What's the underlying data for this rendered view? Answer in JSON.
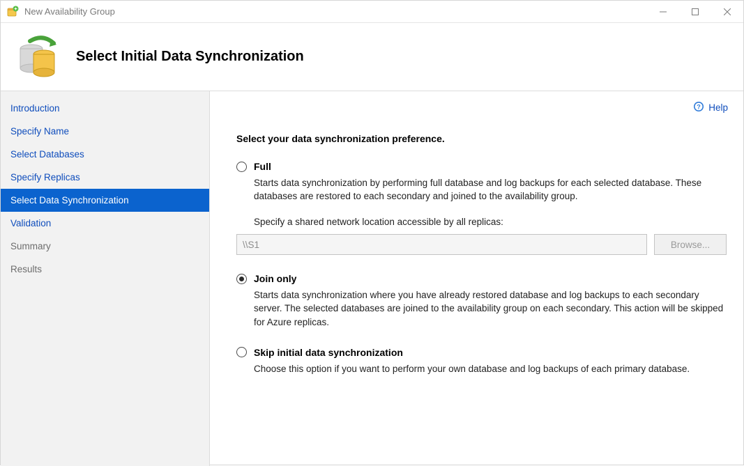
{
  "window": {
    "title": "New Availability Group"
  },
  "header": {
    "title": "Select Initial Data Synchronization"
  },
  "help": {
    "label": "Help"
  },
  "sidebar": {
    "items": [
      {
        "label": "Introduction",
        "state": "link"
      },
      {
        "label": "Specify Name",
        "state": "link"
      },
      {
        "label": "Select Databases",
        "state": "link"
      },
      {
        "label": "Specify Replicas",
        "state": "link"
      },
      {
        "label": "Select Data Synchronization",
        "state": "selected"
      },
      {
        "label": "Validation",
        "state": "link"
      },
      {
        "label": "Summary",
        "state": "muted"
      },
      {
        "label": "Results",
        "state": "muted"
      }
    ]
  },
  "content": {
    "heading": "Select your data synchronization preference.",
    "options": {
      "full": {
        "title": "Full",
        "desc": "Starts data synchronization by performing full database and log backups for each selected database. These databases are restored to each secondary and joined to the availability group.",
        "share_label": "Specify a shared network location accessible by all replicas:",
        "share_value": "\\\\S1",
        "browse_label": "Browse...",
        "checked": false
      },
      "join": {
        "title": "Join only",
        "desc": "Starts data synchronization where you have already restored database and log backups to each secondary server. The selected databases are joined to the availability group on each secondary. This action will be skipped for Azure replicas.",
        "checked": true
      },
      "skip": {
        "title": "Skip initial data synchronization",
        "desc": "Choose this option if you want to perform your own database and log backups of each primary database.",
        "checked": false
      }
    }
  }
}
